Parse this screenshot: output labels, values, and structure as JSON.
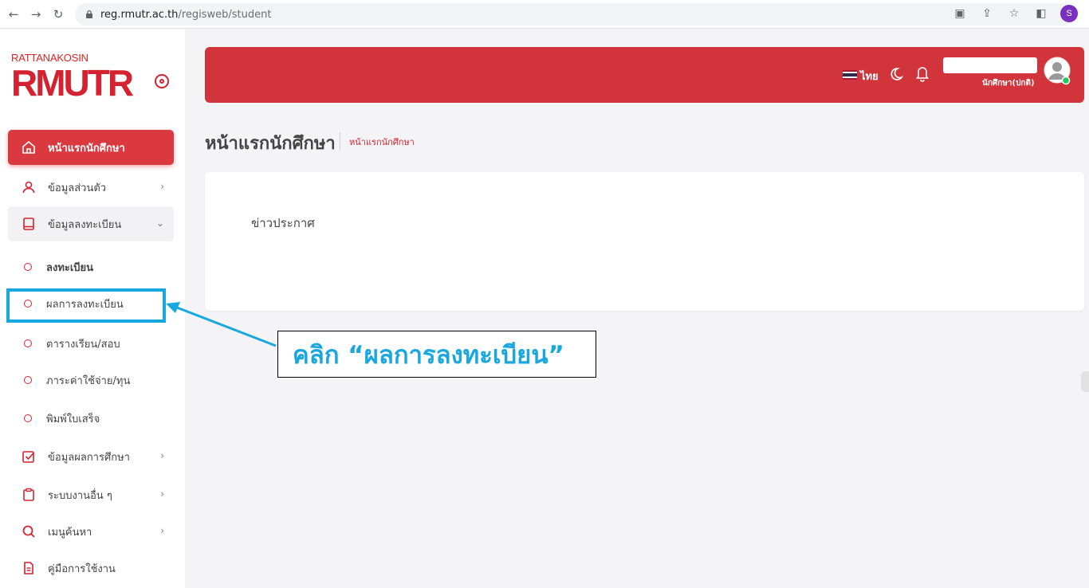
{
  "browser": {
    "url_host": "reg.rmutr.ac.th",
    "url_path": "/regisweb/student",
    "profile_initial": "S"
  },
  "logo": {
    "top_text": "RATTANAKOSIN",
    "main_text": "RMUTR"
  },
  "sidebar": {
    "items": [
      {
        "label": "หน้าแรกนักศึกษา",
        "icon": "home-icon",
        "active": true
      },
      {
        "label": "ข้อมูลส่วนตัว",
        "icon": "user-icon",
        "chevron": "›"
      },
      {
        "label": "ข้อมูลลงทะเบียน",
        "icon": "book-icon",
        "chevron": "⌄"
      }
    ],
    "subitems": [
      {
        "label": "ลงทะเบียน"
      },
      {
        "label": "ผลการลงทะเบียน"
      },
      {
        "label": "ตารางเรียน/สอบ"
      },
      {
        "label": "ภาระค่าใช้จ่าย/ทุน"
      },
      {
        "label": "พิมพ์ใบเสร็จ"
      }
    ],
    "more_items": [
      {
        "label": "ข้อมูลผลการศึกษา",
        "icon": "checkbox-icon",
        "chevron": "›"
      },
      {
        "label": "ระบบงานอื่น ๆ",
        "icon": "clipboard-icon",
        "chevron": "›"
      },
      {
        "label": "เมนูค้นหา",
        "icon": "search-icon",
        "chevron": "›"
      },
      {
        "label": "คู่มือการใช้งาน",
        "icon": "document-icon"
      }
    ]
  },
  "header": {
    "language": "ไทย",
    "role": "นักศึกษา(ปกติ)"
  },
  "main": {
    "page_title": "หน้าแรกนักศึกษา",
    "breadcrumb": "หน้าแรกนักศึกษา",
    "card_title": "ข่าวประกาศ"
  },
  "annotation": {
    "text": "คลิก “ผลการลงทะเบียน”"
  },
  "colors": {
    "brand_red": "#d1343a",
    "annotation_blue": "#19a7e0"
  }
}
